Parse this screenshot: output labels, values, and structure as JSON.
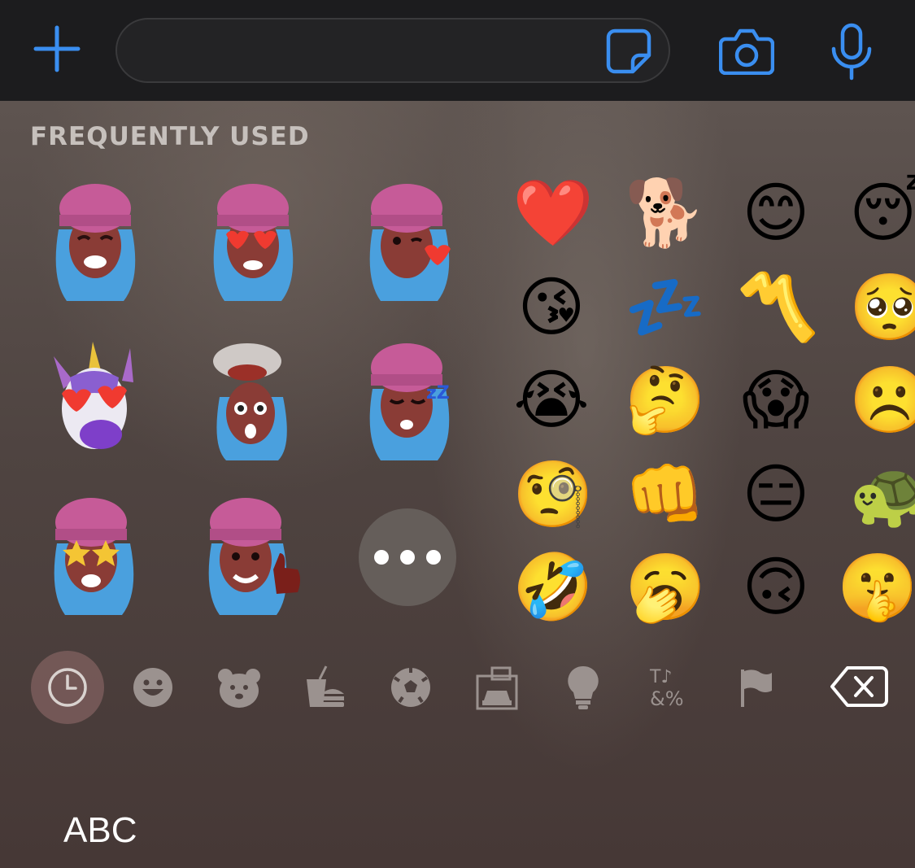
{
  "top_bar": {
    "input_placeholder": "",
    "icons": [
      "plus-icon",
      "sticker-icon",
      "camera-icon",
      "microphone-icon"
    ],
    "accent_color": "#3a8ef0"
  },
  "section": {
    "title": "FREQUENTLY USED"
  },
  "memoji_stickers": [
    "memoji-laughing-tears",
    "memoji-heart-eyes",
    "memoji-kiss-heart",
    "memoji-unicorn-heart-eyes",
    "memoji-exploding-head",
    "memoji-sleeping",
    "memoji-star-struck",
    "memoji-thumbs-up"
  ],
  "more_button": "more-icon",
  "emoji_grid": [
    [
      "❤️",
      "🐕",
      "😊",
      "😴"
    ],
    [
      "😘",
      "💤",
      "〽️",
      "🥺"
    ],
    [
      "😭",
      "🤔",
      "😱",
      "☹️"
    ],
    [
      "🧐",
      "👊",
      "😑",
      "🐢"
    ],
    [
      "🤣",
      "🥱",
      "🙃",
      "🤫"
    ]
  ],
  "categories": [
    "recent-icon",
    "smileys-icon",
    "animals-icon",
    "food-icon",
    "activity-icon",
    "travel-icon",
    "objects-icon",
    "symbols-icon",
    "flags-icon"
  ],
  "bottom": {
    "abc_label": "ABC"
  }
}
